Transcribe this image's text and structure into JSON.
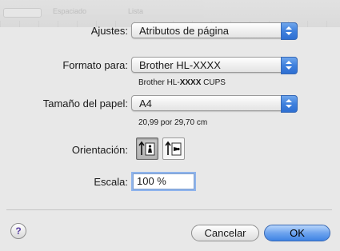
{
  "background_toolbar": {
    "labels": [
      "Espaciado",
      "Lista"
    ]
  },
  "settings": {
    "label": "Ajustes:",
    "value": "Atributos de página"
  },
  "format_for": {
    "label": "Formato para:",
    "value": "Brother HL-XXXX",
    "note_prefix": "Brother HL-",
    "note_bold": "XXXX",
    "note_suffix": " CUPS"
  },
  "paper_size": {
    "label": "Tamaño del papel:",
    "value": "A4",
    "dimensions": "20,99 por 29,70 cm"
  },
  "orientation": {
    "label": "Orientación:",
    "selected": "portrait"
  },
  "scale": {
    "label": "Escala:",
    "value": "100 %"
  },
  "buttons": {
    "help": "?",
    "cancel": "Cancelar",
    "ok": "OK"
  },
  "colors": {
    "accent": "#3f80dd",
    "dialog_bg": "#e8e8e8"
  }
}
